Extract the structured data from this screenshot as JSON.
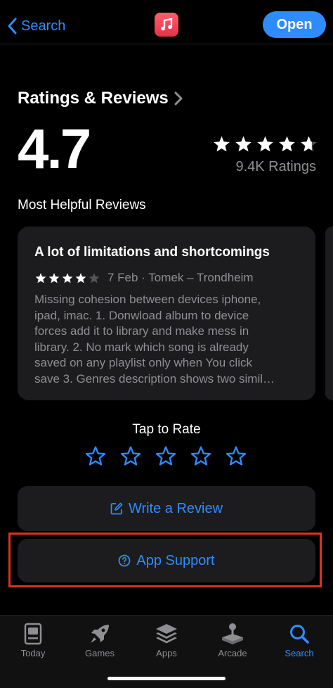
{
  "nav": {
    "back_label": "Search",
    "open_label": "Open"
  },
  "ratings": {
    "title": "Ratings & Reviews",
    "average": "4.7",
    "stars": 4.7,
    "count_label": "9.4K Ratings"
  },
  "reviews": {
    "section_title": "Most Helpful Reviews",
    "items": [
      {
        "title": "A lot of limitations and shortcomings",
        "stars": 4,
        "meta": "7 Feb · Tomek – Trondheim",
        "body_lines": [
          "Missing cohesion between devices iphone,",
          "ipad, imac. 1. Donwload album to device",
          "forces add it to library and make mess in",
          "library. 2. No mark which song is already",
          "saved on any playlist only when You click",
          "save 3. Genres description shows two simil…"
        ]
      }
    ]
  },
  "tap_to_rate": {
    "label": "Tap to Rate"
  },
  "actions": {
    "write_review": "Write a Review",
    "app_support": "App Support"
  },
  "tabbar": {
    "items": [
      {
        "label": "Today",
        "icon": "today-icon"
      },
      {
        "label": "Games",
        "icon": "rocket-icon"
      },
      {
        "label": "Apps",
        "icon": "apps-stack-icon"
      },
      {
        "label": "Arcade",
        "icon": "joystick-icon"
      },
      {
        "label": "Search",
        "icon": "search-icon",
        "active": true
      }
    ]
  },
  "colors": {
    "accent": "#2f8cff",
    "highlight": "#e2301d",
    "card": "#1c1c1e",
    "secondary_text": "#8e8e93"
  }
}
